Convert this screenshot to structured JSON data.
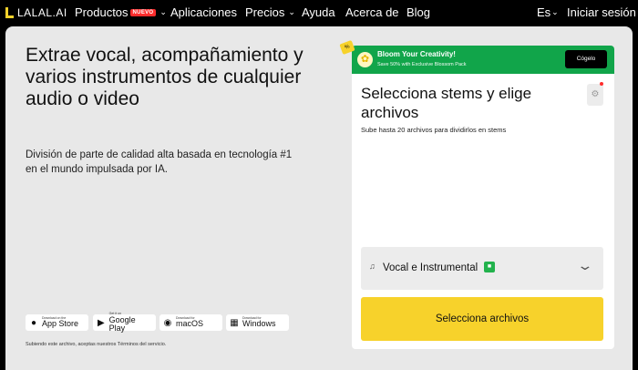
{
  "nav": {
    "logo": "LALAL.AI",
    "items": [
      {
        "label": "Productos",
        "badge": "NUEVO"
      },
      {
        "label": "Aplicaciones"
      },
      {
        "label": "Precios"
      },
      {
        "label": "Ayuda"
      },
      {
        "label": "Acerca de"
      },
      {
        "label": "Blog"
      }
    ],
    "language": "Es",
    "login": "Iniciar sesión"
  },
  "hero": {
    "title": "Extrae vocal, acompañamiento y varios instrumentos de cualquier audio o video",
    "subtitle": "División de parte de calidad alta basada en tecnología #1 en el mundo impulsada por IA."
  },
  "stores": [
    {
      "small": "Download on the",
      "label": "App Store",
      "icon": "apple-icon"
    },
    {
      "small": "Get it on",
      "label": "Google Play",
      "icon": "google-play-icon"
    },
    {
      "small": "Download for",
      "label": "macOS",
      "icon": "macos-icon"
    },
    {
      "small": "Download for",
      "label": "Windows",
      "icon": "windows-icon"
    }
  ],
  "disclaimer": "Subiendo este archivo, aceptas nuestros Términos del servicio.",
  "promo": {
    "tag": "%",
    "title": "Bloom Your Creativity!",
    "subtitle": "Save 50% with Exclusive Blossom Pack",
    "button": "Cógelo"
  },
  "panel": {
    "title": "Selecciona stems y elige archivos",
    "subtitle": "Sube hasta 20 archivos para dividirlos en stems",
    "stem_select": "Vocal e Instrumental",
    "cta": "Selecciona archivos"
  },
  "colors": {
    "accent": "#f7d22b",
    "promo_green": "#11a54a",
    "badge_red": "#ff2d2d"
  }
}
